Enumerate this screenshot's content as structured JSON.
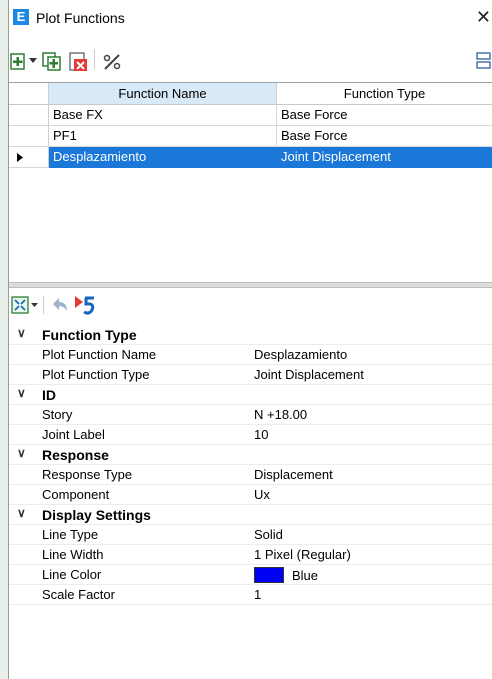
{
  "window": {
    "title": "Plot Functions",
    "app_icon_letter": "E",
    "close_glyph": "✕"
  },
  "grid": {
    "columns": [
      "Function Name",
      "Function Type"
    ],
    "rows": [
      {
        "name": "Base FX",
        "type": "Base Force",
        "selected": false
      },
      {
        "name": "PF1",
        "type": "Base Force",
        "selected": false
      },
      {
        "name": "Desplazamiento",
        "type": "Joint Displacement",
        "selected": true
      }
    ]
  },
  "properties": {
    "function_type": {
      "label": "Function Type",
      "items": [
        {
          "name": "Plot Function Name",
          "value": "Desplazamiento"
        },
        {
          "name": "Plot Function Type",
          "value": "Joint Displacement"
        }
      ]
    },
    "id": {
      "label": "ID",
      "items": [
        {
          "name": "Story",
          "value": "N +18.00"
        },
        {
          "name": "Joint Label",
          "value": "10"
        }
      ]
    },
    "response": {
      "label": "Response",
      "items": [
        {
          "name": "Response Type",
          "value": "Displacement"
        },
        {
          "name": "Component",
          "value": "Ux"
        }
      ]
    },
    "display": {
      "label": "Display Settings",
      "items": [
        {
          "name": "Line Type",
          "value": "Solid"
        },
        {
          "name": "Line Width",
          "value": "1 Pixel (Regular)"
        },
        {
          "name": "Line Color",
          "value": "Blue"
        },
        {
          "name": "Scale Factor",
          "value": "1"
        }
      ]
    }
  },
  "colors": {
    "selection": "#1b78d8",
    "line_color_swatch": "#0000f5"
  },
  "icons": [
    "app-icon",
    "add-function-icon",
    "dropdown-arrow-icon",
    "copy-function-icon",
    "delete-function-icon",
    "percent-scale-icon",
    "expand-collapse-icon",
    "undo-icon",
    "redo-icon",
    "panel-options-icon",
    "row-pointer-icon"
  ]
}
